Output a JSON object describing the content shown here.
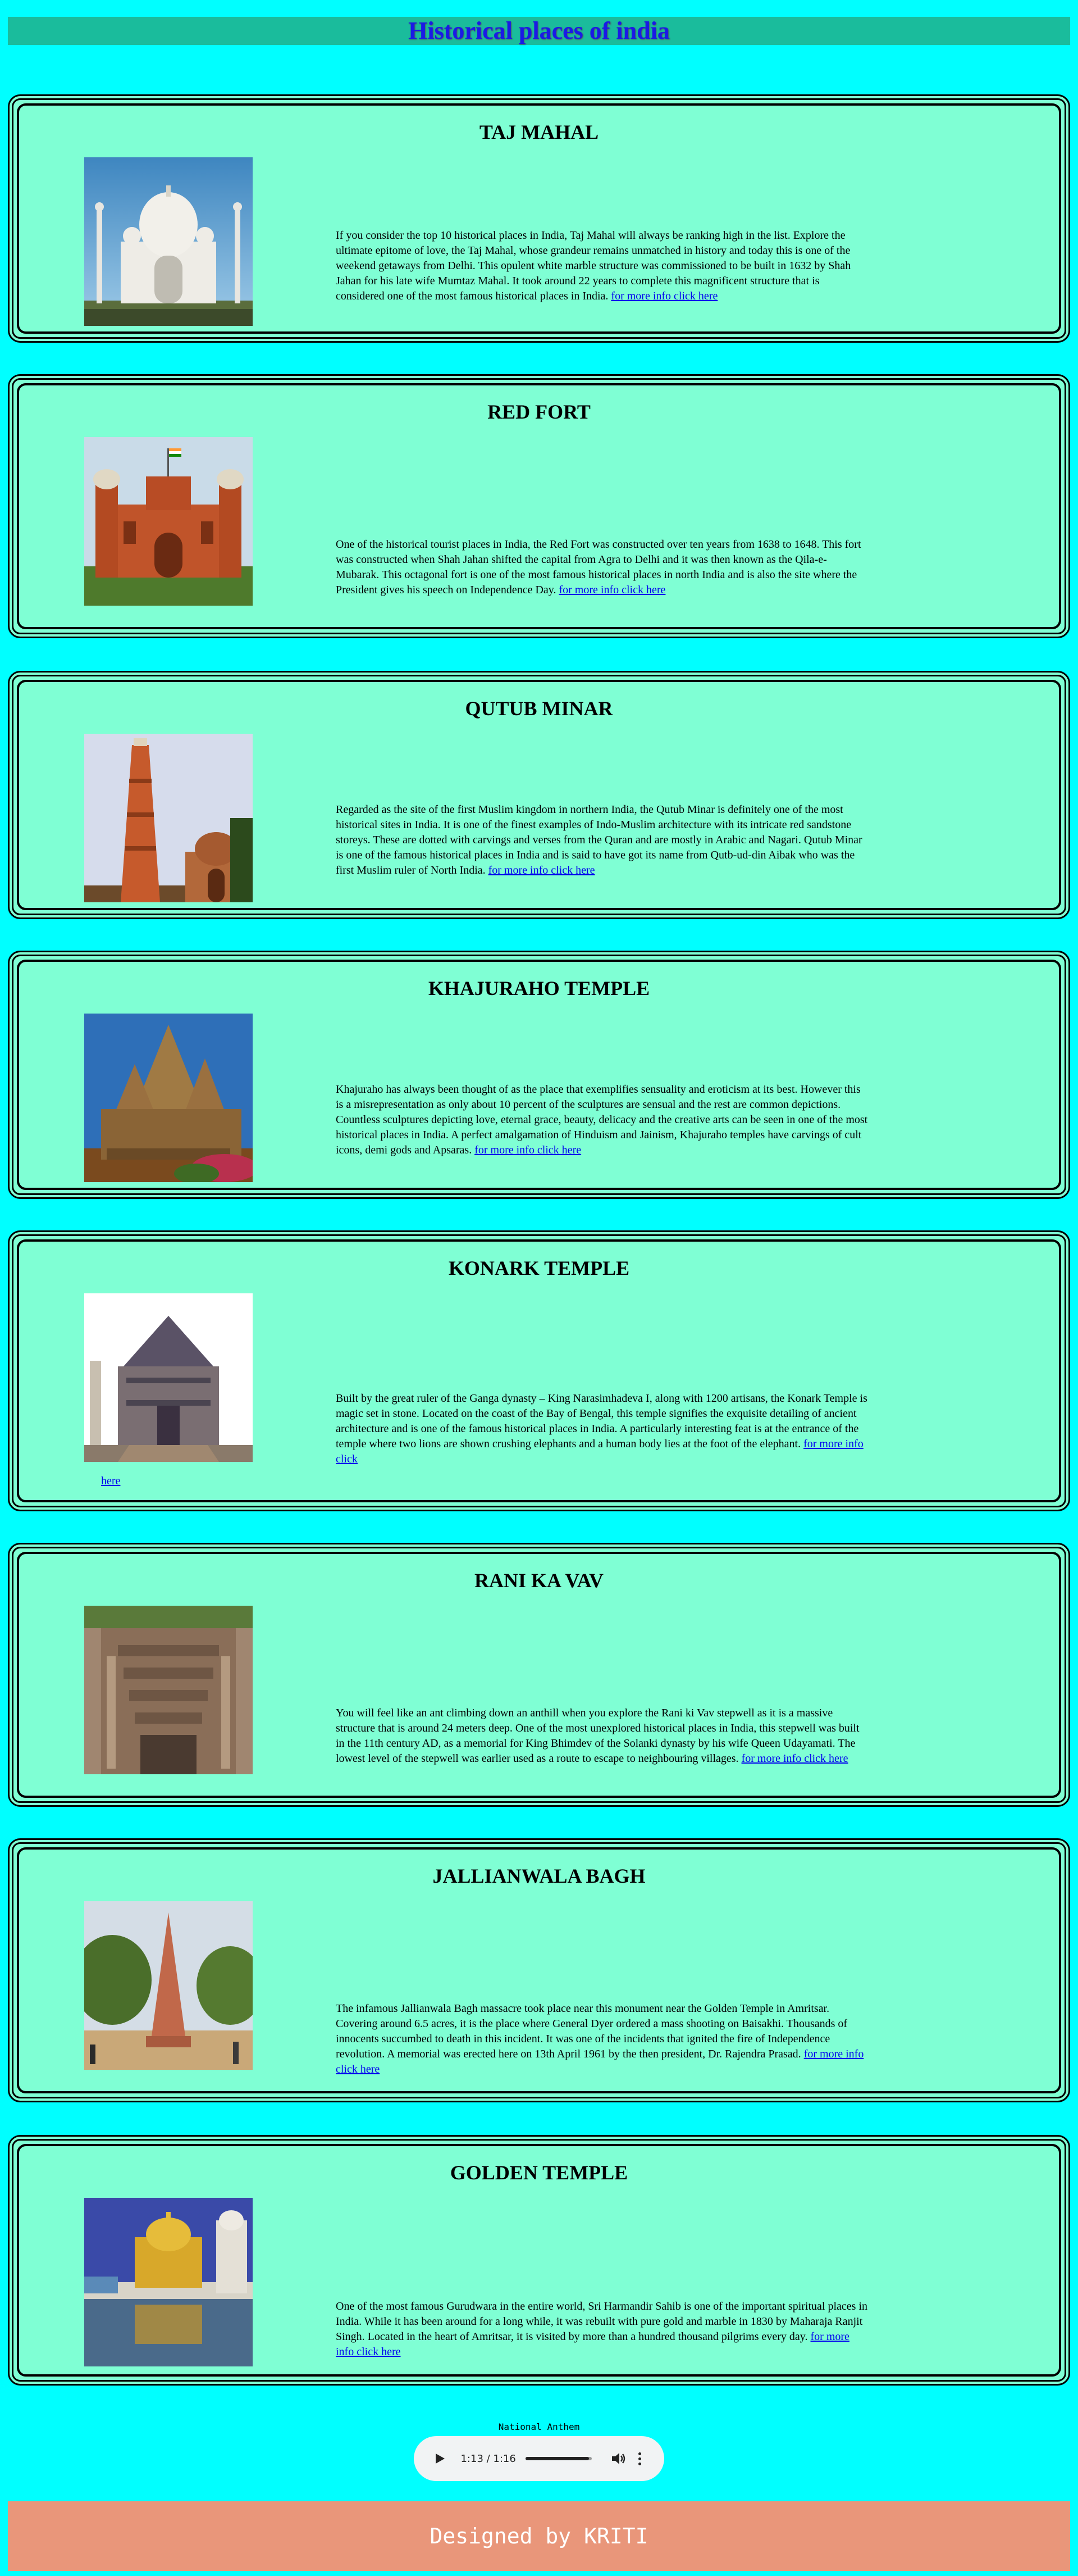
{
  "header": {
    "title": "Historical places of india"
  },
  "places": [
    {
      "title": "TAJ MAHAL",
      "text": "If you consider the top 10 historical places in India, Taj Mahal will always be ranking high in the list. Explore the ultimate epitome of love, the Taj Mahal, whose grandeur remains unmatched in history and today this is one of the weekend getaways from Delhi. This opulent white marble structure was commissioned to be built in 1632 by Shah Jahan for his late wife Mumtaz Mahal. It took around 22 years to complete this magnificent structure that is considered one of the most famous historical places in India.",
      "link": "for more info click here"
    },
    {
      "title": "RED FORT",
      "text": "One of the historical tourist places in India, the Red Fort was constructed over ten years from 1638 to 1648. This fort was constructed when Shah Jahan shifted the capital from Agra to Delhi and it was then known as the Qila-e-Mubarak. This octagonal fort is one of the most famous historical places in north India and is also the site where the President gives his speech on Independence Day.",
      "link": "for more info click here"
    },
    {
      "title": "QUTUB MINAR",
      "text": "Regarded as the site of the first Muslim kingdom in northern India, the Qutub Minar is definitely one of the most historical sites in India. It is one of the finest examples of Indo-Muslim architecture with its intricate red sandstone storeys. These are dotted with carvings and verses from the Quran and are mostly in Arabic and Nagari. Qutub Minar is one of the famous historical places in India and is said to have got its name from Qutb-ud-din Aibak who was the first Muslim ruler of North India.",
      "link": "for more info click here"
    },
    {
      "title": "KHAJURAHO TEMPLE",
      "text": "Khajuraho has always been thought of as the place that exemplifies sensuality and eroticism at its best. However this is a misrepresentation as only about 10 percent of the sculptures are sensual and the rest are common depictions. Countless sculptures depicting love, eternal grace, beauty, delicacy and the creative arts can be seen in one of the most historical places in India. A perfect amalgamation of Hinduism and Jainism, Khajuraho temples have carvings of cult icons, demi gods and Apsaras.",
      "link": "for more info click here"
    },
    {
      "title": "KONARK TEMPLE",
      "text": "Built by the great ruler of the Ganga dynasty – King Narasimhadeva I, along with 1200 artisans, the Konark Temple is magic set in stone. Located on the coast of the Bay of Bengal, this temple signifies the exquisite detailing of ancient architecture and is one of the famous historical places in India. A particularly interesting feat is at the entrance of the temple where two lions are shown crushing elephants and a human body lies at the foot of the elephant.",
      "link": "for more info click",
      "link_extra": "here"
    },
    {
      "title": "RANI KA VAV",
      "text": "You will feel like an ant climbing down an anthill when you explore the Rani ki Vav stepwell as it is a massive structure that is around 24 meters deep. One of the most unexplored historical places in India, this stepwell was built in the 11th century AD, as a memorial for King Bhimdev of the Solanki dynasty by his wife Queen Udayamati. The lowest level of the stepwell was earlier used as a route to escape to neighbouring villages.",
      "link": "for more info click here"
    },
    {
      "title": "JALLIANWALA BAGH",
      "text": "The infamous Jallianwala Bagh massacre took place near this monument near the Golden Temple in Amritsar. Covering around 6.5 acres, it is the place where General Dyer ordered a mass shooting on Baisakhi. Thousands of innocents succumbed to death in this incident. It was one of the incidents that ignited the fire of Independence revolution. A memorial was erected here on 13th April 1961 by the then president, Dr. Rajendra Prasad.",
      "link": "for more info click here"
    },
    {
      "title": "GOLDEN TEMPLE",
      "text": "One of the most famous Gurudwara in the entire world, Sri Harmandir Sahib is one of the important spiritual places in India. While it has been around for a long while, it was rebuilt with pure gold and marble in 1830 by Maharaja Ranjit Singh. Located in the heart of Amritsar, it is visited by more than a hundred thousand pilgrims every day.",
      "link": "for more info click here"
    }
  ],
  "audio": {
    "title": "National Anthem",
    "time": "1:13 / 1:16",
    "progress": 0.96
  },
  "footer": {
    "text": "Designed by KRITI"
  },
  "colors": {
    "page_bg": "#00ffff",
    "header_bg": "#1abc9c",
    "header_text": "#1a1ae6",
    "card_bg": "#7fffd4",
    "footer_bg": "#e9967a",
    "link": "#0000ee"
  },
  "icons": [
    "play-icon",
    "volume-icon",
    "more-options-icon"
  ]
}
